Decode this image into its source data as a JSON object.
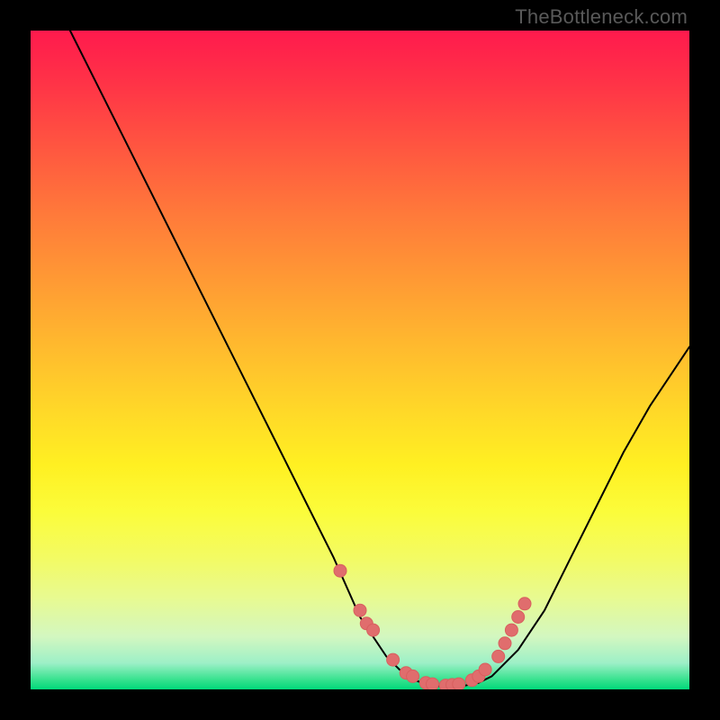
{
  "watermark": "TheBottleneck.com",
  "colors": {
    "curve": "#000000",
    "dot_fill": "#e06d6d",
    "dot_stroke": "#d85f5f"
  },
  "chart_data": {
    "type": "line",
    "title": "",
    "xlabel": "",
    "ylabel": "",
    "xlim": [
      0,
      100
    ],
    "ylim": [
      0,
      100
    ],
    "annotations": [
      "V-shaped bottleneck curve on red-yellow-green gradient"
    ],
    "series": [
      {
        "name": "curve-left",
        "x": [
          6,
          10,
          14,
          18,
          22,
          26,
          30,
          34,
          38,
          42,
          46,
          50,
          52,
          54,
          56,
          58
        ],
        "y": [
          100,
          92,
          84,
          76,
          68,
          60,
          52,
          44,
          36,
          28,
          20,
          11,
          8,
          5,
          3,
          1.5
        ]
      },
      {
        "name": "curve-bottom",
        "x": [
          58,
          60,
          62,
          64,
          66,
          68,
          70
        ],
        "y": [
          1.5,
          0.8,
          0.5,
          0.5,
          0.6,
          1.0,
          2.0
        ]
      },
      {
        "name": "curve-right",
        "x": [
          70,
          74,
          78,
          82,
          86,
          90,
          94,
          98,
          100
        ],
        "y": [
          2.0,
          6,
          12,
          20,
          28,
          36,
          43,
          49,
          52
        ]
      }
    ],
    "dots": {
      "name": "highlight-dots",
      "x": [
        47,
        50,
        51,
        52,
        55,
        57,
        58,
        60,
        61,
        63,
        64,
        65,
        67,
        68,
        69,
        71,
        72,
        73,
        74,
        75
      ],
      "y": [
        18,
        12,
        10,
        9,
        4.5,
        2.5,
        2,
        1,
        0.8,
        0.6,
        0.7,
        0.8,
        1.4,
        2,
        3,
        5,
        7,
        9,
        11,
        13
      ]
    }
  }
}
